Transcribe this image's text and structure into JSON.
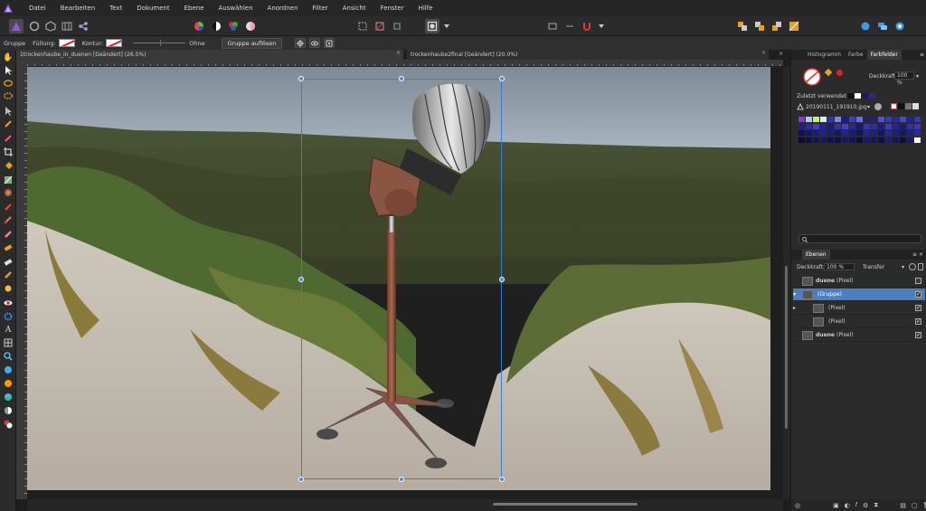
{
  "menubar": {
    "items": [
      "Datei",
      "Bearbeiten",
      "Text",
      "Dokument",
      "Ebene",
      "Auswählen",
      "Anordnen",
      "Filter",
      "Ansicht",
      "Fenster",
      "Hilfe"
    ]
  },
  "contextbar": {
    "selection_type": "Gruppe",
    "fill_label": "Füllung:",
    "stroke_label": "Kontur:",
    "stroke_style": "Ohne",
    "ungroup_button": "Gruppe auflösen"
  },
  "tabs": [
    {
      "label": "1trockenhaube_in_duenen [Geändert] (26.5%)",
      "active": true,
      "close": "×"
    },
    {
      "label": "trockenhaube2final [Geändert] (20.0%)",
      "active": false,
      "close": "×"
    }
  ],
  "swatches_panel": {
    "tabs": [
      "Histogramm",
      "Farbe",
      "Farbfelder"
    ],
    "active_tab": "Farbfelder",
    "opacity_label": "Deckkraft:",
    "opacity_value": "100 %",
    "recent_label": "Zuletzt verwendet:",
    "palette_name": "20190111_191910.jpg",
    "search_placeholder": ""
  },
  "layers_panel": {
    "title": "Ebenen",
    "opacity_label": "Deckkraft:",
    "opacity_value": "100 %",
    "blend_mode": "Transfer",
    "layers": [
      {
        "name": "duene",
        "type": "(Pixel)",
        "selected": false,
        "indent": 0,
        "visible": false
      },
      {
        "name": "",
        "type": "(Gruppe)",
        "selected": true,
        "indent": 0,
        "visible": true
      },
      {
        "name": "",
        "type": "(Pixel)",
        "selected": false,
        "indent": 1,
        "visible": true
      },
      {
        "name": "",
        "type": "(Pixel)",
        "selected": false,
        "indent": 1,
        "visible": true
      },
      {
        "name": "duene",
        "type": "(Pixel)",
        "selected": false,
        "indent": 0,
        "visible": true
      }
    ]
  },
  "colors": {
    "accent": "#4a7fc1",
    "selection": "#3b7bd6",
    "brand": "#7b3fe4"
  }
}
